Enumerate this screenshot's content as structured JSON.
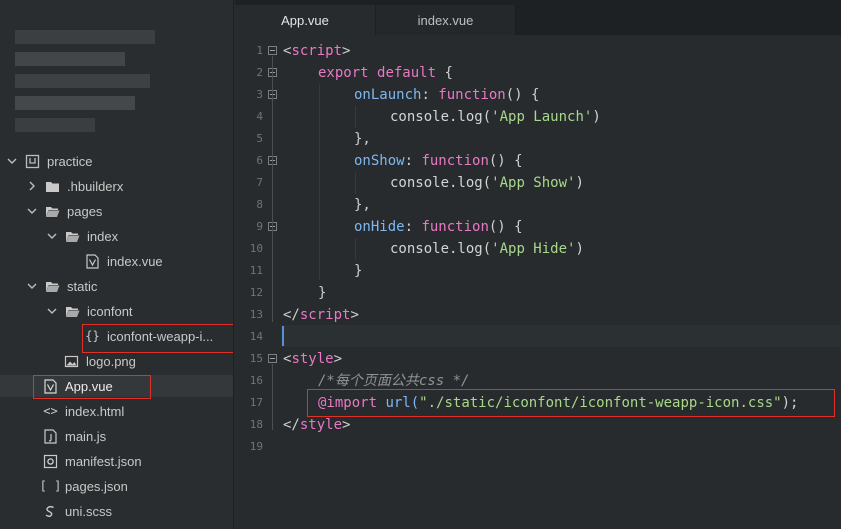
{
  "sidebar": {
    "root": {
      "label": "practice"
    },
    "items": [
      {
        "label": ".hbuilderx"
      },
      {
        "label": "pages"
      },
      {
        "label": "index"
      },
      {
        "label": "index.vue"
      },
      {
        "label": "static"
      },
      {
        "label": "iconfont"
      },
      {
        "label": "iconfont-weapp-i..."
      },
      {
        "label": "logo.png"
      },
      {
        "label": "App.vue"
      },
      {
        "label": "index.html"
      },
      {
        "label": "main.js"
      },
      {
        "label": "manifest.json"
      },
      {
        "label": "pages.json"
      },
      {
        "label": "uni.scss"
      }
    ]
  },
  "tabs": [
    {
      "label": "App.vue",
      "active": true
    },
    {
      "label": "index.vue",
      "active": false
    }
  ],
  "line_numbers": [
    "1",
    "2",
    "3",
    "4",
    "5",
    "6",
    "7",
    "8",
    "9",
    "10",
    "11",
    "12",
    "13",
    "14",
    "15",
    "16",
    "17",
    "18",
    "19"
  ],
  "code": {
    "l1": {
      "open": "<",
      "tag": "script",
      "close": ">"
    },
    "l2": {
      "kw1": "export",
      "kw2": "default",
      "brace": " {"
    },
    "l3": {
      "prop": "onLaunch",
      "colon": ": ",
      "fn": "function",
      "rest": "() {"
    },
    "l4": {
      "obj": "console.log(",
      "str": "'App Launch'",
      "end": ")"
    },
    "l5": {
      "text": "},"
    },
    "l6": {
      "prop": "onShow",
      "colon": ": ",
      "fn": "function",
      "rest": "() {"
    },
    "l7": {
      "obj": "console.log(",
      "str": "'App Show'",
      "end": ")"
    },
    "l8": {
      "text": "},"
    },
    "l9": {
      "prop": "onHide",
      "colon": ": ",
      "fn": "function",
      "rest": "() {"
    },
    "l10": {
      "obj": "console.log(",
      "str": "'App Hide'",
      "end": ")"
    },
    "l11": {
      "text": "}"
    },
    "l12": {
      "text": "}"
    },
    "l13": {
      "open": "</",
      "tag": "script",
      "close": ">"
    },
    "l15": {
      "open": "<",
      "tag": "style",
      "close": ">"
    },
    "l16": {
      "comment": "/*每个页面公共css */"
    },
    "l17": {
      "at": "@import",
      "url": " url(",
      "str": "\"./static/iconfont/iconfont-weapp-icon.css\"",
      "end": ");"
    },
    "l18": {
      "open": "</",
      "tag": "style",
      "close": ">"
    }
  },
  "colors": {
    "accent_highlight": "#e0302a",
    "cursor": "#5b8fd4",
    "keyword": "#e879c4",
    "string": "#a8d88a",
    "property": "#7fb7ee"
  },
  "icons": {
    "project": "project-icon",
    "folder": "folder-icon",
    "vue_file": "vue-file-icon",
    "css_file": "braces-file-icon",
    "image_file": "image-file-icon",
    "html_file": "code-file-icon",
    "js_file": "js-file-icon",
    "json_file": "json-file-icon",
    "scss_file": "scss-file-icon"
  }
}
